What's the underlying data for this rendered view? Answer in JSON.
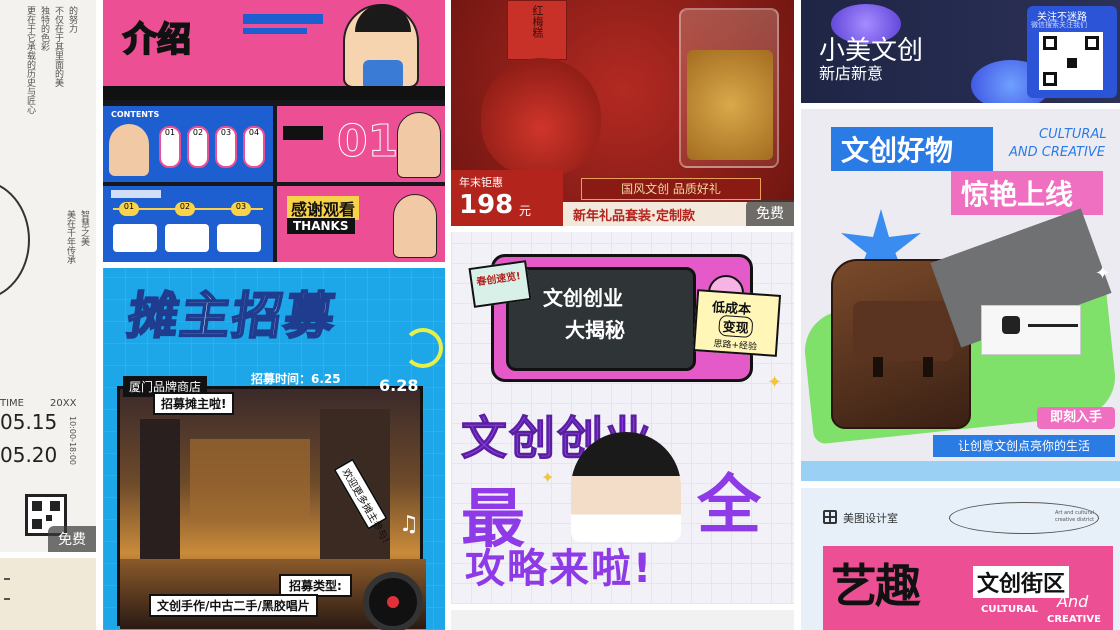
{
  "free_badge": "免费",
  "tile0": {
    "vertical_lines": [
      "的努力",
      "不仅在于其里面的美",
      "独特的色彩",
      "更在于它承载的历史与匠心"
    ],
    "vertical_lines_2": [
      "智慧之美",
      "美在千年传承"
    ],
    "time_label": "TIME",
    "year_label": "20XX",
    "date_start": "05.15",
    "date_end": "05.20",
    "hours_text": "10:00-18:00"
  },
  "tile1": {
    "title": "介绍",
    "contents_label": "CONTENTS",
    "content_numbers": [
      "01",
      "02",
      "03",
      "04"
    ],
    "big_number": "01",
    "thanks_cn": "感谢观看",
    "thanks_en": "THANKS",
    "step_numbers": [
      "01",
      "02",
      "03"
    ]
  },
  "tile2": {
    "title": "摊主招募",
    "subtitle_1": "厦门品牌商店",
    "subtitle_2": "招募摊主啦!",
    "time_label": "招募时间：6.25",
    "time_end": "6.28",
    "callout": "欢迎更多摊主参与!",
    "type_label": "招募类型:",
    "types": "文创手作/中古二手/黑胶唱片"
  },
  "tile3": {
    "box_text": "红梅糕",
    "ribbon": "国风文创 品质好礼",
    "tag_top": "年末钜惠",
    "price": "198",
    "price_unit": "元",
    "caption": "新年礼品套装·定制款"
  },
  "tile4": {
    "sticker_left": "春创速览!",
    "tv_line1": "文创创业",
    "tv_line2": "大揭秘",
    "note_line1": "低成本",
    "note_line2": "变现",
    "note_line3": "思路+经验",
    "headline_1": "文创创业",
    "headline_2a": "最",
    "headline_2b": "全",
    "headline_3": "攻略来啦!"
  },
  "tile5": {
    "follow_text": "关注不迷路",
    "follow_sub": "微信搜索关注我们",
    "title": "小美文创",
    "subtitle": "新店新意"
  },
  "tile6": {
    "title_1": "文创好物",
    "title_2": "惊艳上线",
    "en_1": "CULTURAL",
    "en_2": "AND CREATIVE",
    "cta": "即刻入手",
    "bottom_text": "让创意文创点亮你的生活"
  },
  "tile7": {
    "brand": "美图设计室",
    "small_en": "Art and cultural creative district",
    "big_1": "艺趣",
    "big_2": "文创街区",
    "en_1": "CULTURAL",
    "en_2": "And",
    "en_3": "CREATIVE"
  },
  "colors": {
    "pink": "#ec4f93",
    "blue": "#1d5fd0",
    "red": "#b3241d",
    "purple": "#8e3ae6",
    "cyan": "#1ea7e8"
  }
}
